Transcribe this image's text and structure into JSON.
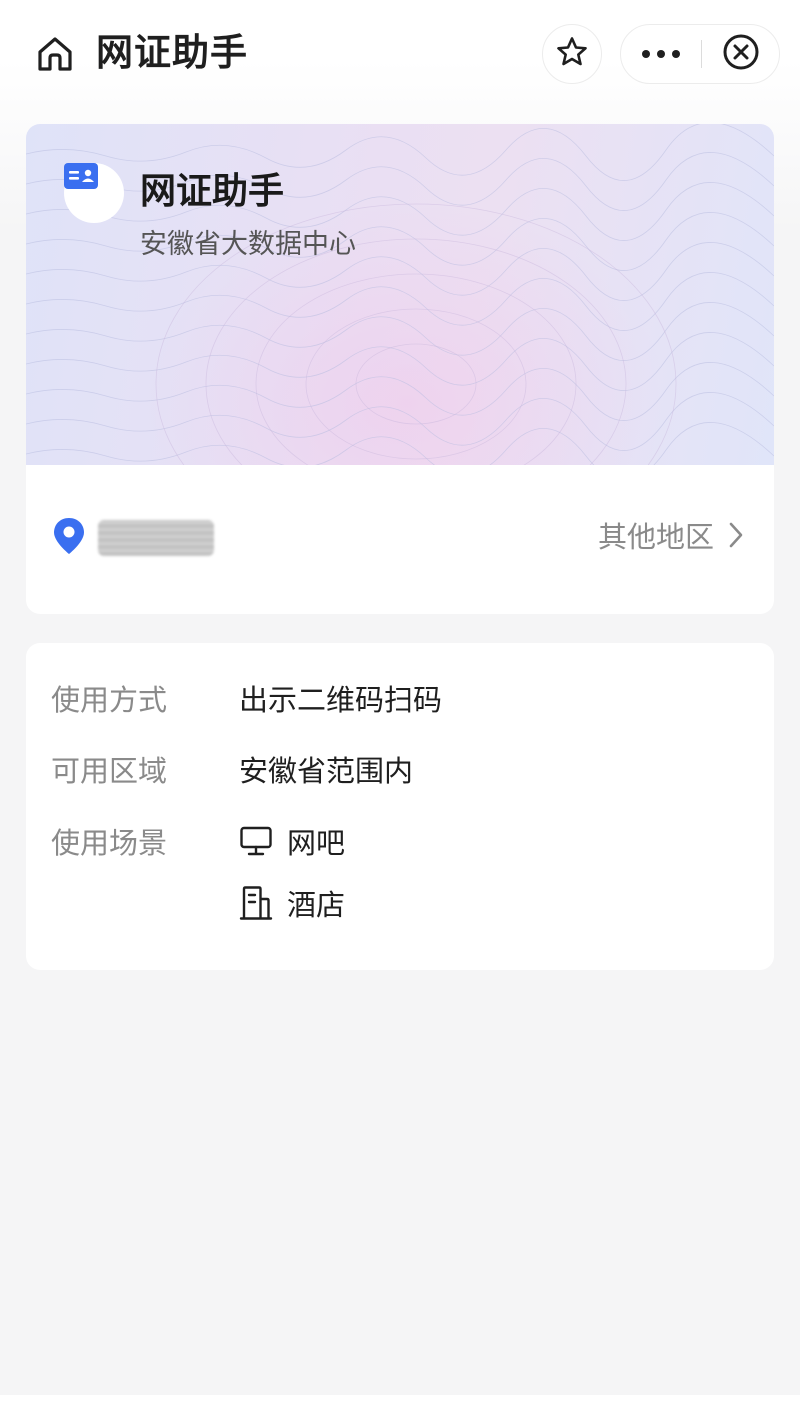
{
  "navbar": {
    "title": "网证助手",
    "home_icon": "home-icon",
    "favorite_icon": "star-icon",
    "more_icon": "more-dots-icon",
    "close_icon": "close-circle-icon"
  },
  "card": {
    "title": "网证助手",
    "subtitle": "安徽省大数据中心",
    "badge_icon": "id-card-icon",
    "accent": "#3a6ff0"
  },
  "location": {
    "pin_icon": "location-pin-icon",
    "current_value": "",
    "other_region_label": "其他地区",
    "chevron_icon": "chevron-right-icon"
  },
  "details": {
    "usage_label": "使用方式",
    "usage_value": "出示二维码扫码",
    "area_label": "可用区域",
    "area_value": "安徽省范围内",
    "scene_label": "使用场景",
    "scenes": [
      {
        "icon": "monitor-icon",
        "label": "网吧"
      },
      {
        "icon": "building-icon",
        "label": "酒店"
      }
    ]
  }
}
